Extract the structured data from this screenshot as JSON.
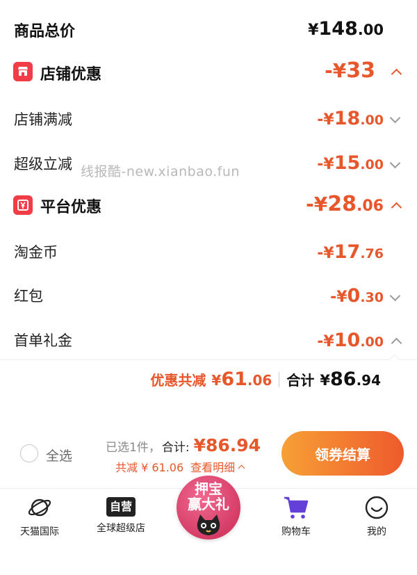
{
  "summary": {
    "total_label": "商品总价",
    "total_symbol": "¥",
    "total_int": "148",
    "total_dec": ".00"
  },
  "store_section": {
    "title": "店铺优惠",
    "amount_prefix": "-¥",
    "amount_int": "33",
    "amount_dec": "",
    "items": [
      {
        "label": "店铺满减",
        "prefix": "-¥",
        "int": "18",
        "dec": ".00"
      },
      {
        "label": "超级立减",
        "prefix": "-¥",
        "int": "15",
        "dec": ".00"
      }
    ]
  },
  "watermark": "线报酷-new.xianbao.fun",
  "platform_section": {
    "title": "平台优惠",
    "amount_prefix": "-¥",
    "amount_int": "28",
    "amount_dec": ".06",
    "items": [
      {
        "label": "淘金币",
        "prefix": "-¥",
        "int": "17",
        "dec": ".76"
      },
      {
        "label": "红包",
        "prefix": "-¥",
        "int": "0",
        "dec": ".30"
      },
      {
        "label": "首单礼金",
        "prefix": "-¥",
        "int": "10",
        "dec": ".00"
      }
    ]
  },
  "totals_line": {
    "discount_label": "优惠共减",
    "discount_symbol": "¥",
    "discount_int": "61",
    "discount_dec": ".06",
    "sum_label": "合计",
    "sum_symbol": "¥",
    "sum_int": "86",
    "sum_dec": ".94"
  },
  "checkout_bar": {
    "select_all": "全选",
    "selected_count": "已选1件，",
    "sum_label": "合计:",
    "sum_value": "¥86.94",
    "saved_text": "共减 ¥ 61.06",
    "detail_link": "查看明细",
    "checkout_button": "领券结算"
  },
  "promo": {
    "line1": "押宝",
    "line2": "赢大礼"
  },
  "bottom_nav": [
    {
      "label": "天猫国际",
      "icon": "planet-icon"
    },
    {
      "label": "全球超级店",
      "icon": "ziying-badge-icon",
      "badge": "自营"
    },
    {
      "label": "购物车",
      "icon": "cart-icon"
    },
    {
      "label": "我的",
      "icon": "smiley-icon"
    }
  ],
  "colors": {
    "accent": "#e8572b",
    "badge_red": "#f23d49",
    "button_start": "#f7a036",
    "button_end": "#ee5a2c",
    "cart_purple": "#6440d8"
  }
}
